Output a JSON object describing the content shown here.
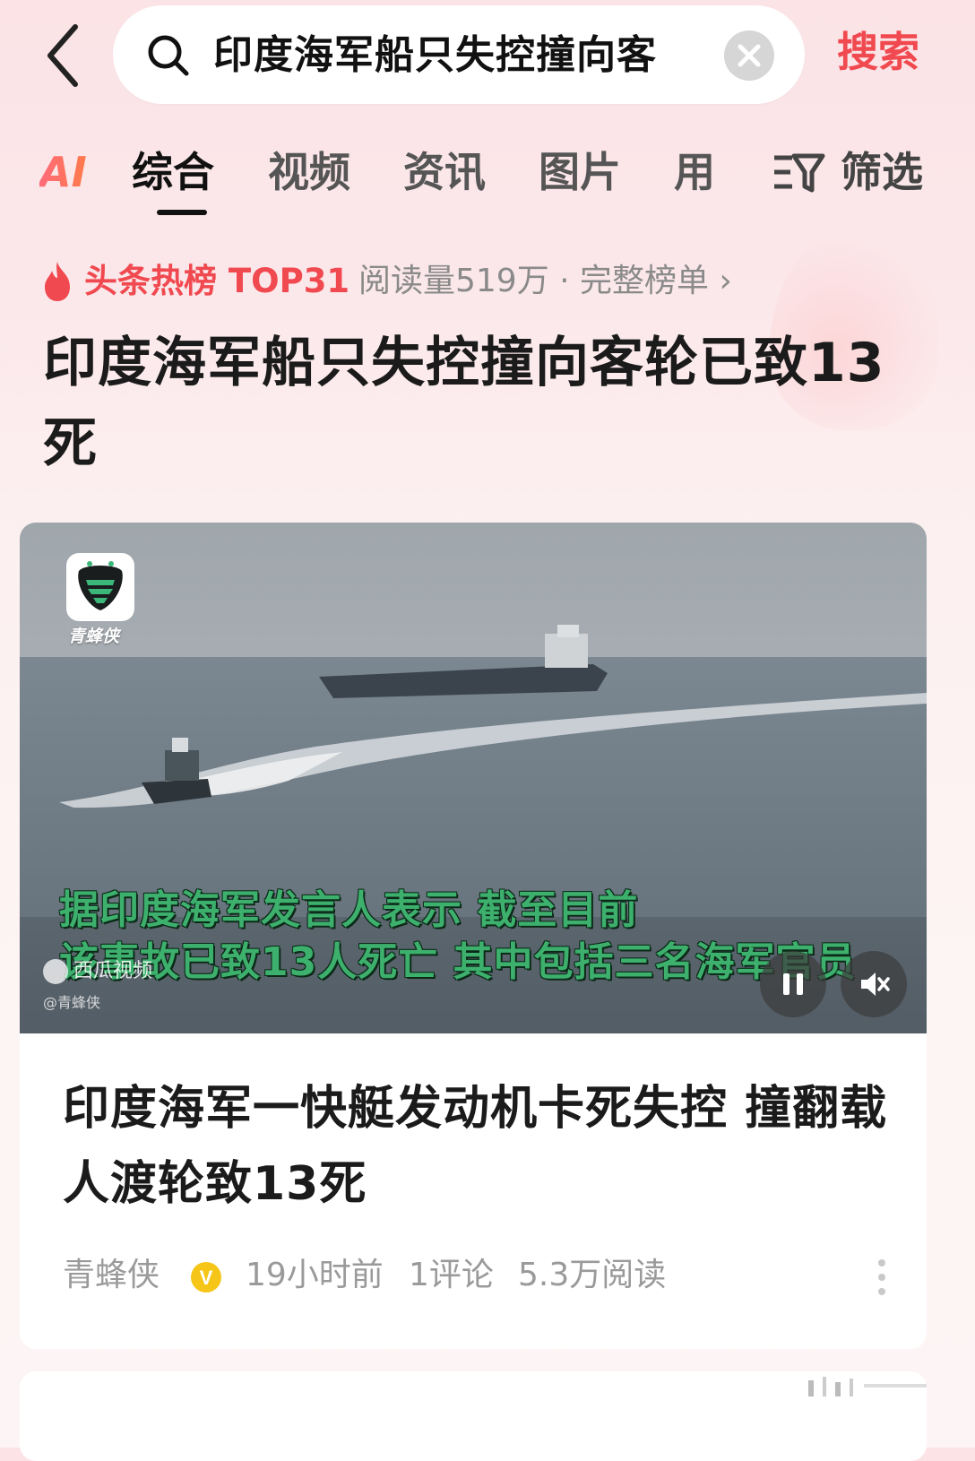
{
  "search": {
    "query": "印度海军船只失控撞向客",
    "submit_label": "搜索"
  },
  "tabs": {
    "ai_label": "AI",
    "items": [
      {
        "label": "综合",
        "active": true
      },
      {
        "label": "视频"
      },
      {
        "label": "资讯"
      },
      {
        "label": "图片"
      },
      {
        "label": "用"
      }
    ],
    "filter_label": "筛选"
  },
  "hot": {
    "label": "头条热榜 TOP31",
    "meta": "阅读量519万 · 完整榜单 ›",
    "color": "#f0494f"
  },
  "headline": "印度海军船只失控撞向客轮已致13死",
  "card": {
    "video": {
      "channel_logo_label": "青蜂侠",
      "subtitle_line1": "据印度海军发言人表示 截至目前",
      "subtitle_line2": "该事故已致13人死亡 其中包括三名海军官员",
      "watermark": "西瓜视频",
      "watermark_handle": "@青蜂侠",
      "subtitle_color": "#3db06d"
    },
    "title": "印度海军一快艇发动机卡死失控 撞翻载人渡轮致13死",
    "author": "青蜂侠",
    "verified_badge": "V",
    "time": "19小时前",
    "comments": "1评论",
    "reads": "5.3万阅读"
  },
  "icons": {
    "back": "chevron-left-icon",
    "search": "search-icon",
    "clear": "close-icon",
    "filter": "filter-icon",
    "fire": "fire-icon",
    "pause": "pause-icon",
    "mute": "mute-icon",
    "more": "more-vertical-icon"
  }
}
